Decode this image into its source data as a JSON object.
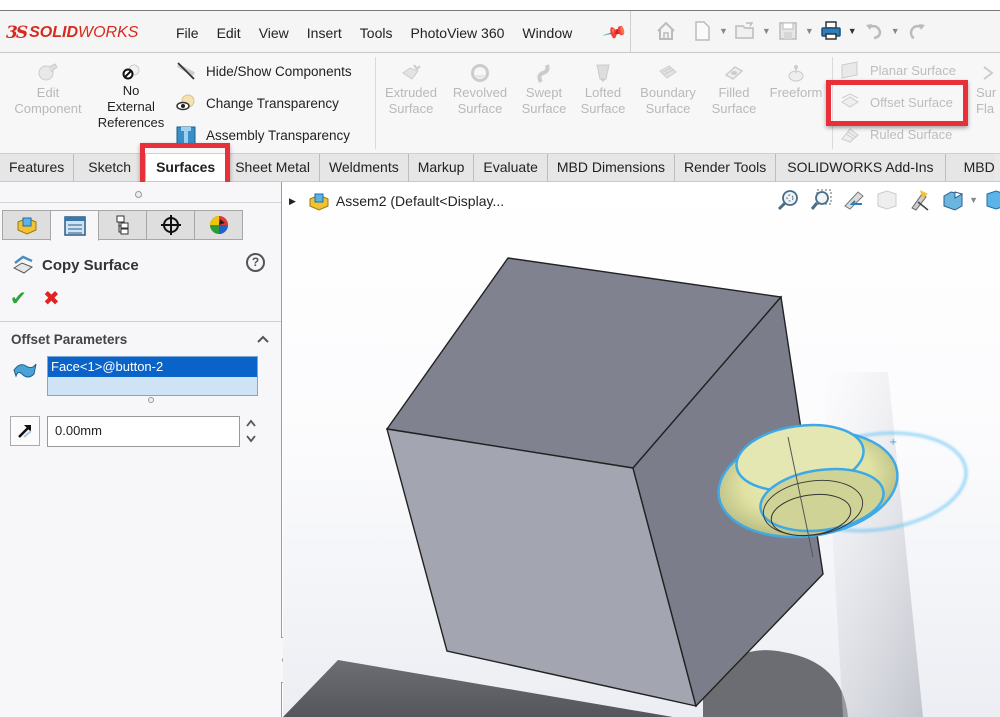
{
  "app": {
    "brand_prefix": "3S",
    "brand_bold": "SOLID",
    "brand_light": "WORKS"
  },
  "menu": [
    "File",
    "Edit",
    "View",
    "Insert",
    "Tools",
    "PhotoView 360",
    "Window"
  ],
  "quick_access": [
    "home-icon",
    "new-document-icon",
    "open-folder-icon",
    "save-icon",
    "print-icon",
    "undo-icon",
    "redo-icon"
  ],
  "ribbon": {
    "edit_component": {
      "line1": "Edit",
      "line2": "Component"
    },
    "no_external_refs": {
      "line1": "No",
      "line2": "External",
      "line3": "References"
    },
    "hide_show": "Hide/Show Components",
    "change_transparency": "Change Transparency",
    "assembly_transparency": "Assembly Transparency",
    "surface_tools": [
      {
        "line1": "Extruded",
        "line2": "Surface"
      },
      {
        "line1": "Revolved",
        "line2": "Surface"
      },
      {
        "line1": "Swept",
        "line2": "Surface"
      },
      {
        "line1": "Lofted",
        "line2": "Surface"
      },
      {
        "line1": "Boundary",
        "line2": "Surface"
      },
      {
        "line1": "Filled",
        "line2": "Surface"
      },
      {
        "line1": "Freeform",
        "line2": ""
      }
    ],
    "planar_surface": "Planar Surface",
    "offset_surface": "Offset Surface",
    "ruled_surface": "Ruled Surface",
    "surface_flatten": {
      "line1": "Sur",
      "line2": "Fla"
    },
    "highlight_color": "#e8303a"
  },
  "tabs": [
    {
      "label": "Features",
      "active": false
    },
    {
      "label": "Sketch",
      "active": false
    },
    {
      "label": "Surfaces",
      "active": true
    },
    {
      "label": "Sheet Metal",
      "active": false
    },
    {
      "label": "Weldments",
      "active": false
    },
    {
      "label": "Markup",
      "active": false
    },
    {
      "label": "Evaluate",
      "active": false
    },
    {
      "label": "MBD Dimensions",
      "active": false
    },
    {
      "label": "Render Tools",
      "active": false
    },
    {
      "label": "SOLIDWORKS Add-Ins",
      "active": false
    },
    {
      "label": "MBD",
      "active": false
    }
  ],
  "property_manager": {
    "title": "Copy Surface",
    "help": "?",
    "ok": "✔",
    "cancel": "✖",
    "group_title": "Offset Parameters",
    "collapse": "^",
    "selection": "Face<1>@button-2",
    "distance_value": "0.00mm",
    "panel_tabs": [
      "feature-manager-icon",
      "property-manager-icon",
      "configuration-manager-icon",
      "dimxpert-icon",
      "display-manager-icon"
    ],
    "accent_color": "#0a63c9"
  },
  "viewport": {
    "tree_root": "Assem2  (Default<Display...",
    "hud_icons": [
      "zoom-to-fit-icon",
      "zoom-to-area-icon",
      "previous-view-icon",
      "section-view-icon",
      "view-orientation-icon",
      "display-style-icon",
      "hide-show-items-icon"
    ]
  }
}
